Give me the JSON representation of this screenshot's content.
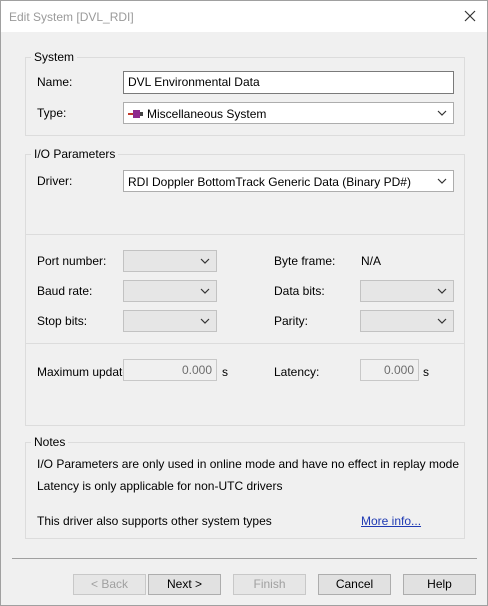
{
  "window": {
    "title": "Edit System [DVL_RDI]"
  },
  "system_group": {
    "title": "System",
    "name_label": "Name:",
    "name_value": "DVL Environmental Data",
    "type_label": "Type:",
    "type_value": "Miscellaneous System",
    "type_icon": "misc-system-icon"
  },
  "io_group": {
    "title": "I/O Parameters",
    "driver_label": "Driver:",
    "driver_value": "RDI Doppler BottomTrack Generic Data (Binary PD#)",
    "port_label": "Port number:",
    "baud_label": "Baud rate:",
    "stop_label": "Stop bits:",
    "byte_frame_label": "Byte frame:",
    "byte_frame_value": "N/A",
    "data_bits_label": "Data bits:",
    "parity_label": "Parity:",
    "max_update_label": "Maximum update rate:",
    "max_update_value": "0.000",
    "max_update_unit": "s",
    "latency_label": "Latency:",
    "latency_value": "0.000",
    "latency_unit": "s"
  },
  "notes_group": {
    "title": "Notes",
    "line1": "I/O Parameters are only used in online mode and have no effect in replay mode",
    "line2": "Latency is only applicable for non-UTC drivers",
    "line3": "This driver also supports other system types",
    "more_info": "More info..."
  },
  "buttons": {
    "back": "< Back",
    "next": "Next >",
    "finish": "Finish",
    "cancel": "Cancel",
    "help": "Help"
  }
}
